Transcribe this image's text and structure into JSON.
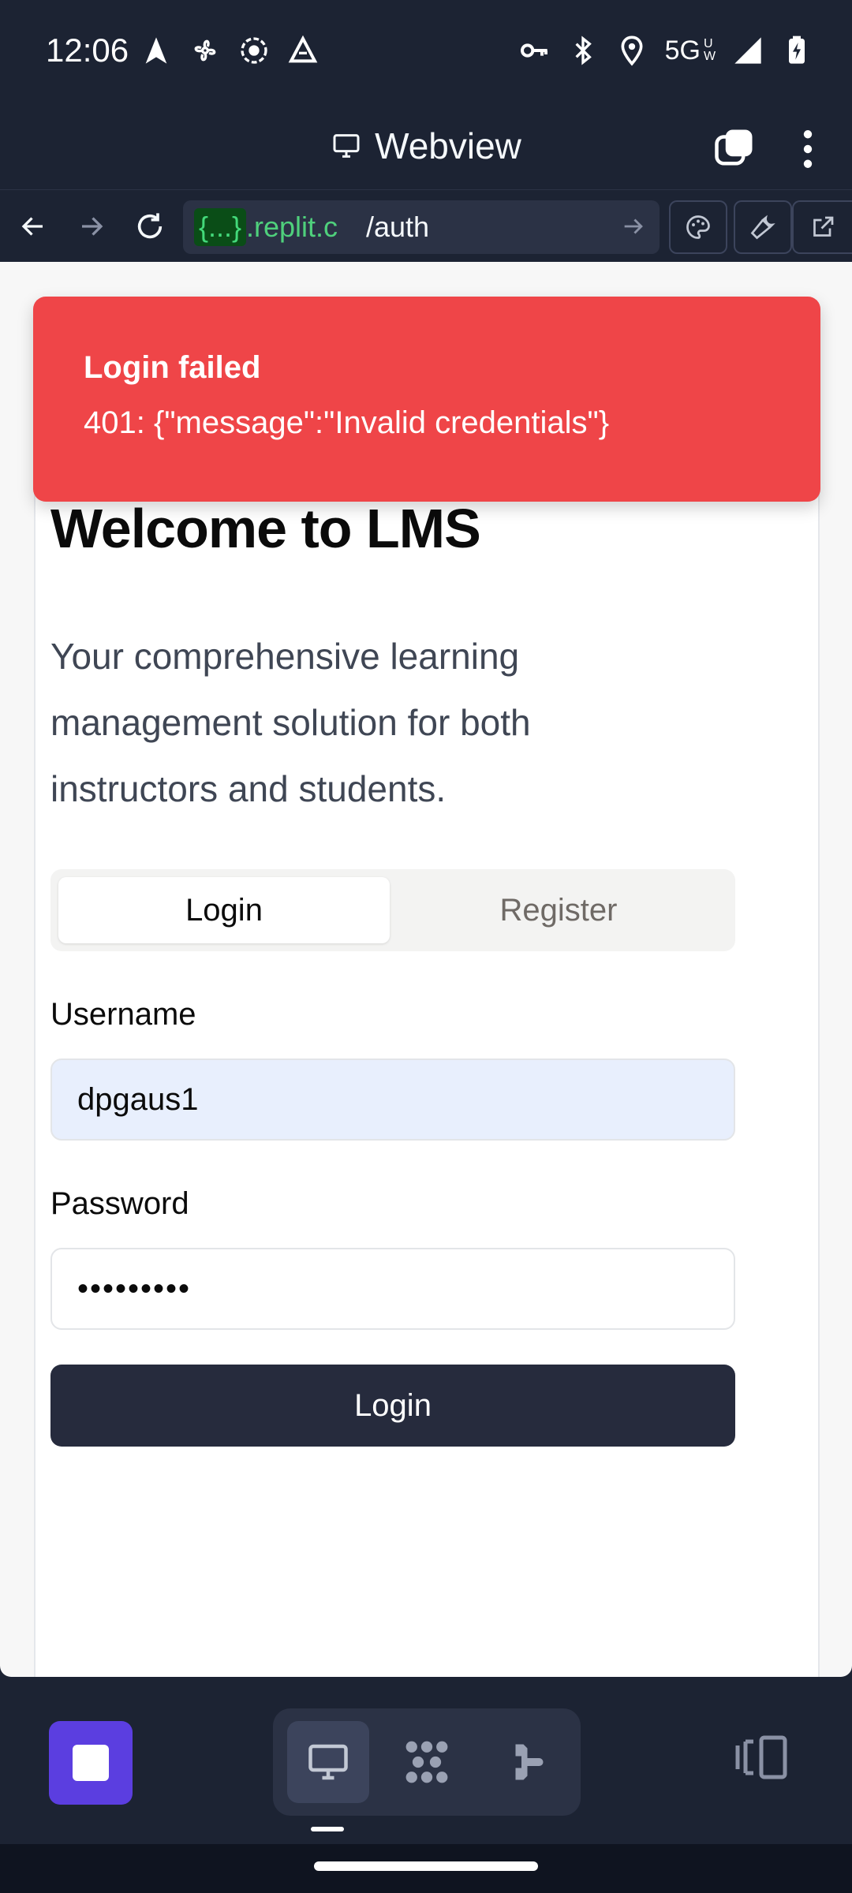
{
  "status_bar": {
    "time": "12:06",
    "network": "5G",
    "network_superscript": "UW",
    "left_icons": [
      "navigation-icon",
      "fan-icon",
      "record-icon",
      "app-icon"
    ],
    "right_icons": [
      "vpn-key-icon",
      "bluetooth-icon",
      "location-icon",
      "signal-icon",
      "battery-charging-icon"
    ]
  },
  "webview": {
    "title": "Webview",
    "icon": "monitor-icon"
  },
  "url_bar": {
    "host_chip": "{...}",
    "host": ".replit.c",
    "path": "/auth"
  },
  "toast": {
    "title": "Login failed",
    "description": "401: {\"message\":\"Invalid credentials\"}"
  },
  "auth_card": {
    "heading": "Welcome to LMS",
    "subtitle": "Your comprehensive learning management solution for both instructors and students.",
    "tabs": [
      {
        "label": "Login",
        "active": true
      },
      {
        "label": "Register",
        "active": false
      }
    ],
    "username_label": "Username",
    "username_value": "dpgaus1",
    "password_label": "Password",
    "password_value": "•••••••••",
    "submit_label": "Login"
  },
  "bottom_bar": {
    "panes": [
      "webview-pane-icon",
      "workspace-pane-icon",
      "agent-pane-icon"
    ],
    "active_pane": "webview-pane-icon"
  },
  "colors": {
    "toast_bg": "#ef4548",
    "accent": "#5b3ee0",
    "submit_bg": "#262b3d",
    "url_host": "#4fd07c"
  }
}
